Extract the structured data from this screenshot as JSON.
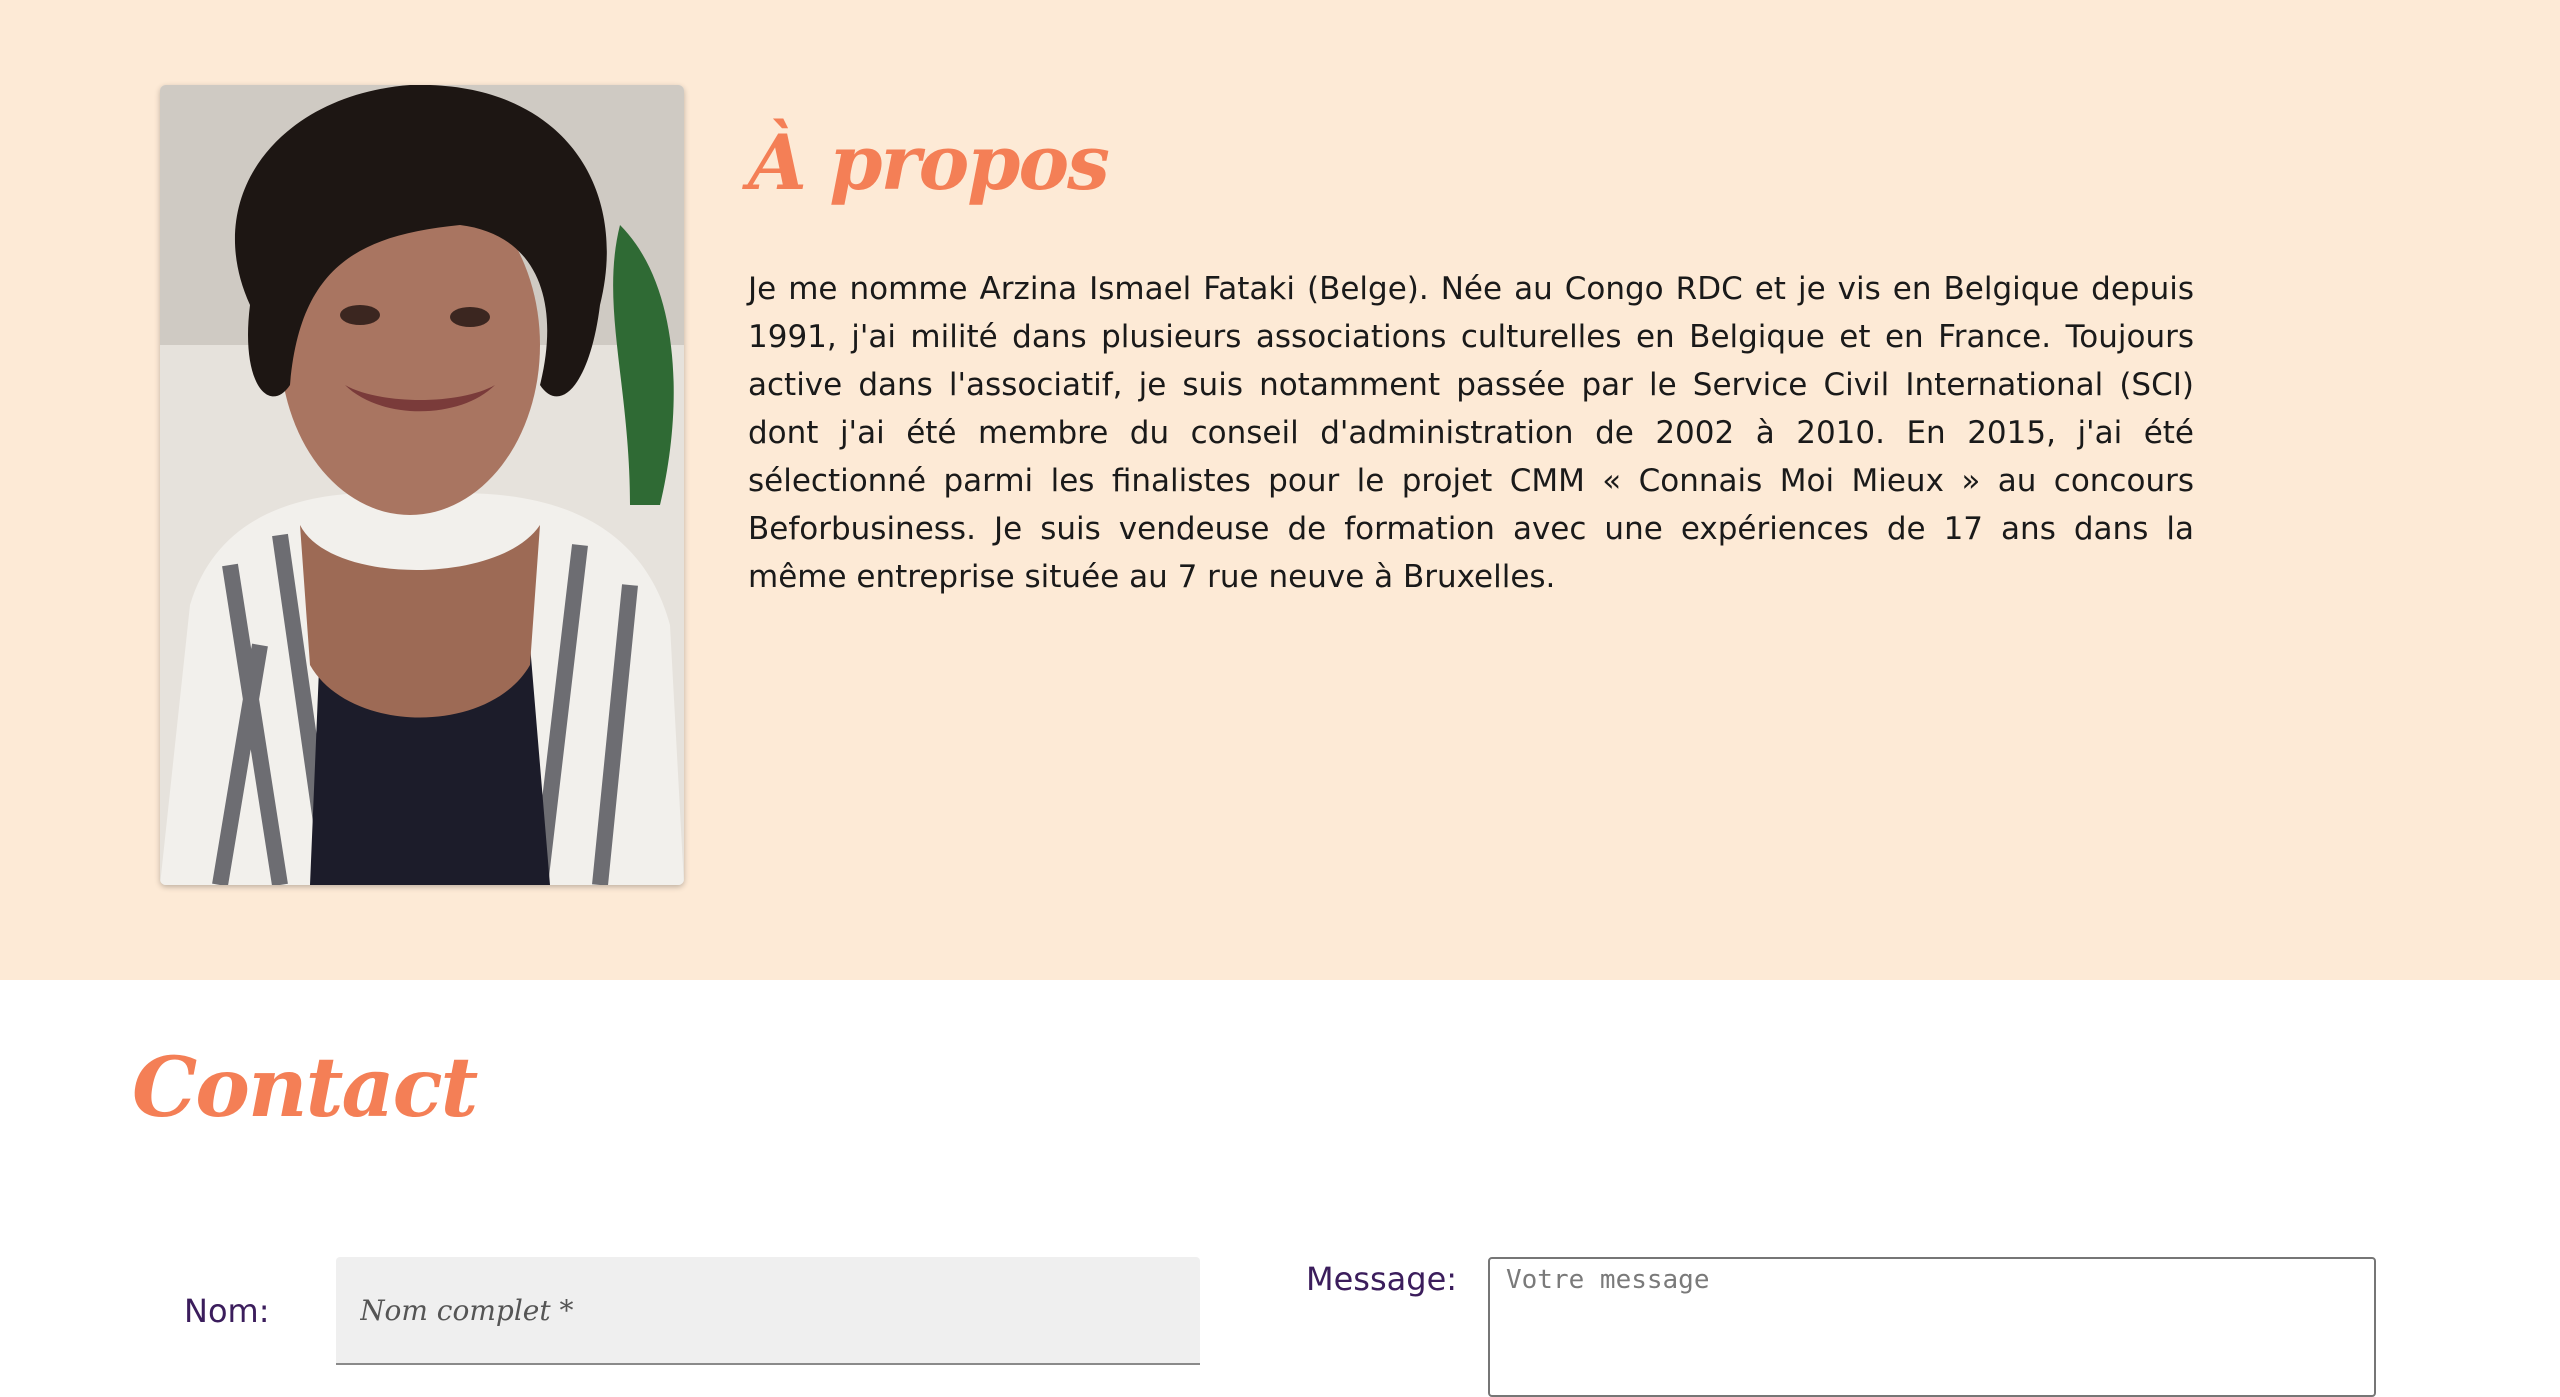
{
  "about": {
    "title": "À propos",
    "text": "Je me nomme Arzina Ismael Fataki (Belge). Née au Congo RDC et je vis en Belgique depuis 1991, j'ai milité dans plusieurs associations culturelles en Belgique et en France. Toujours active dans l'associatif, je suis notamment passée par le Service Civil International (SCI) dont j'ai été membre du conseil d'administration de 2002 à 2010. En 2015, j'ai été sélectionné parmi les finalistes pour le projet CMM « Connais Moi Mieux » au concours Beforbusiness. Je suis vendeuse de formation avec une expériences de 17 ans dans la même entreprise située au 7 rue neuve à Bruxelles."
  },
  "contact": {
    "title": "Contact",
    "nom_label": "Nom:",
    "nom_placeholder": "Nom complet *",
    "message_label": "Message:",
    "message_placeholder": "Votre message"
  },
  "colors": {
    "about_background": "#fdead6",
    "accent": "#f47f56",
    "label": "#3b1d5c"
  }
}
